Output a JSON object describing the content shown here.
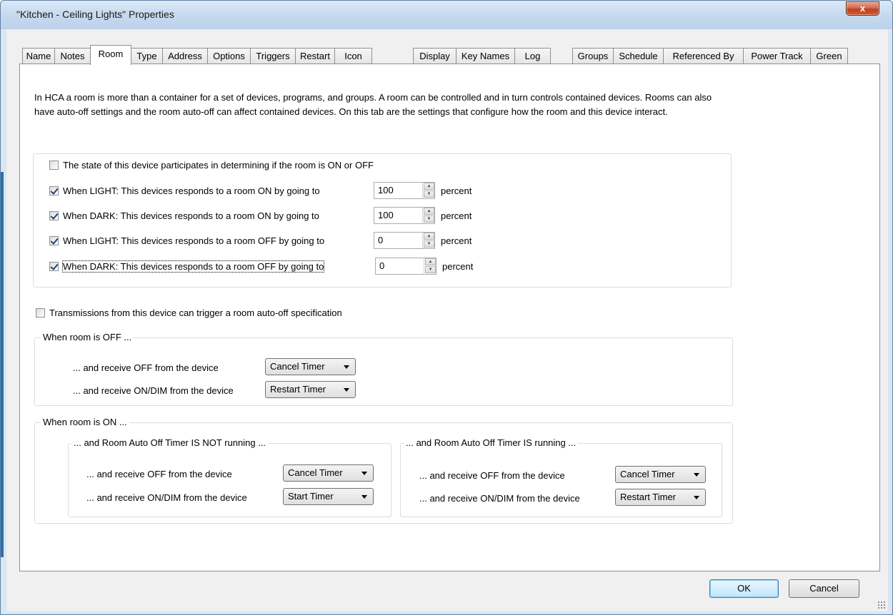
{
  "window": {
    "title": "\"Kitchen - Ceiling Lights\" Properties",
    "close_glyph": "x"
  },
  "tabs": [
    {
      "label": "Name"
    },
    {
      "label": "Notes"
    },
    {
      "label": "Room",
      "active": true
    },
    {
      "label": "Type"
    },
    {
      "label": "Address"
    },
    {
      "label": "Options"
    },
    {
      "label": "Triggers"
    },
    {
      "label": "Restart"
    },
    {
      "label": "Icon"
    },
    {
      "label": "Display"
    },
    {
      "label": "Key Names"
    },
    {
      "label": "Log"
    },
    {
      "label": "Groups"
    },
    {
      "label": "Schedule"
    },
    {
      "label": "Referenced By"
    },
    {
      "label": "Power Track"
    },
    {
      "label": "Green"
    }
  ],
  "intro_text": "In HCA a room is more than a container for a set of devices, programs, and groups.  A room can be controlled and in turn controls contained devices.  Rooms can also have auto-off settings and the room auto-off can affect contained devices.  On this tab are the settings that configure how the room and this device interact.",
  "participation": {
    "label": "The state of this device participates in determining if the room is ON or OFF",
    "checked": false
  },
  "responses": [
    {
      "label": "When LIGHT: This devices responds to a room ON by going to",
      "checked": true,
      "value": "100",
      "unit": "percent"
    },
    {
      "label": "When DARK: This devices responds to a room ON by going to",
      "checked": true,
      "value": "100",
      "unit": "percent"
    },
    {
      "label": "When LIGHT: This devices responds to a room OFF by going to",
      "checked": true,
      "value": "0",
      "unit": "percent"
    },
    {
      "label": "When DARK: This devices responds to a room OFF by going to",
      "checked": true,
      "value": "0",
      "unit": "percent"
    }
  ],
  "auto_off": {
    "label": "Transmissions from this device can trigger a room auto-off specification",
    "checked": false
  },
  "room_off": {
    "title": "When room is OFF ...",
    "off_label": "... and receive OFF from the device",
    "off_value": "Cancel Timer",
    "on_label": "... and receive ON/DIM from the device",
    "on_value": "Restart Timer"
  },
  "room_on": {
    "title": "When room is ON ...",
    "not_running": {
      "title": "... and Room Auto Off Timer IS NOT running ...",
      "off_label": "... and receive OFF from the device",
      "off_value": "Cancel Timer",
      "on_label": "... and receive ON/DIM from the device",
      "on_value": "Start Timer"
    },
    "running": {
      "title": "... and Room Auto Off Timer IS running ...",
      "off_label": "... and receive OFF from the device",
      "off_value": "Cancel Timer",
      "on_label": "... and receive ON/DIM from the device",
      "on_value": "Restart Timer"
    }
  },
  "buttons": {
    "ok": "OK",
    "cancel": "Cancel"
  }
}
